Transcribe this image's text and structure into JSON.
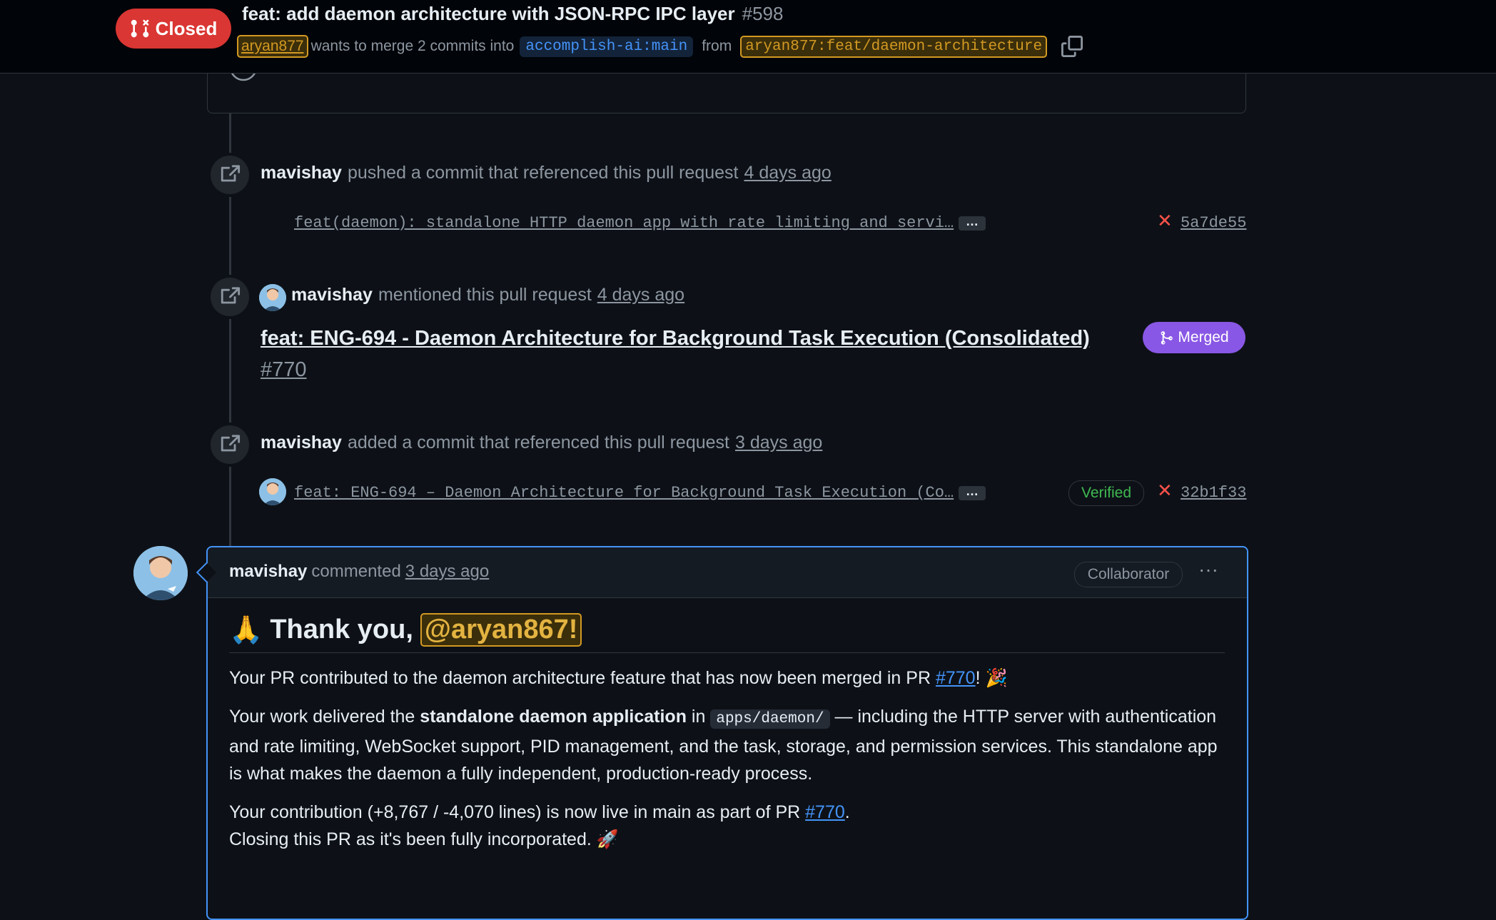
{
  "header": {
    "state": "Closed",
    "title": "feat: add daemon architecture with JSON-RPC IPC layer",
    "number": "#598",
    "author": "aryan877",
    "merge_text": "wants to merge 2 commits into",
    "base_branch": "accomplish-ai:main",
    "from_text": "from",
    "head_branch": "aryan877:feat/daemon-architecture"
  },
  "timeline": [
    {
      "actor": "mavishay",
      "action": "pushed a commit that referenced this pull request",
      "time": "4 days ago",
      "commit_message": "feat(daemon): standalone HTTP daemon app with rate limiting and servi…",
      "ellipsis": "…",
      "sha": "5a7de55"
    },
    {
      "actor": "mavishay",
      "action": "mentioned this pull request",
      "time": "4 days ago",
      "ref_title": "feat: ENG-694 - Daemon Architecture for Background Task Execution (Consolidated)",
      "ref_number": "#770",
      "ref_state": "Merged"
    },
    {
      "actor": "mavishay",
      "action": "added a commit that referenced this pull request",
      "time": "3 days ago",
      "commit_message": "feat: ENG-694 – Daemon Architecture for Background Task Execution (Co…",
      "ellipsis": "…",
      "verified": "Verified",
      "sha": "32b1f33"
    }
  ],
  "comment": {
    "author": "mavishay",
    "action": "commented",
    "time": "3 days ago",
    "role": "Collaborator",
    "kebab": "···",
    "heading_emoji": "🙏",
    "heading_text": "Thank you,",
    "heading_mention": "@aryan867!",
    "p1_before": "Your PR contributed to the daemon architecture feature that has now been merged in PR",
    "p1_link": "#770",
    "p1_after": "! 🎉",
    "p2_before": "Your work delivered the",
    "p2_bold": "standalone daemon application",
    "p2_in": "in",
    "p2_code": "apps/daemon/",
    "p2_after": "— including the HTTP server with authentication and rate limiting, WebSocket support, PID management, and the task, storage, and permission services. This standalone app is what makes the daemon a fully independent, production-ready process.",
    "p3_before": "Your contribution (+8,767 / -4,070 lines) is now live in main as part of PR",
    "p3_link": "#770",
    "p3_after": ".",
    "p4": "Closing this PR as it's been fully incorporated. 🚀"
  }
}
